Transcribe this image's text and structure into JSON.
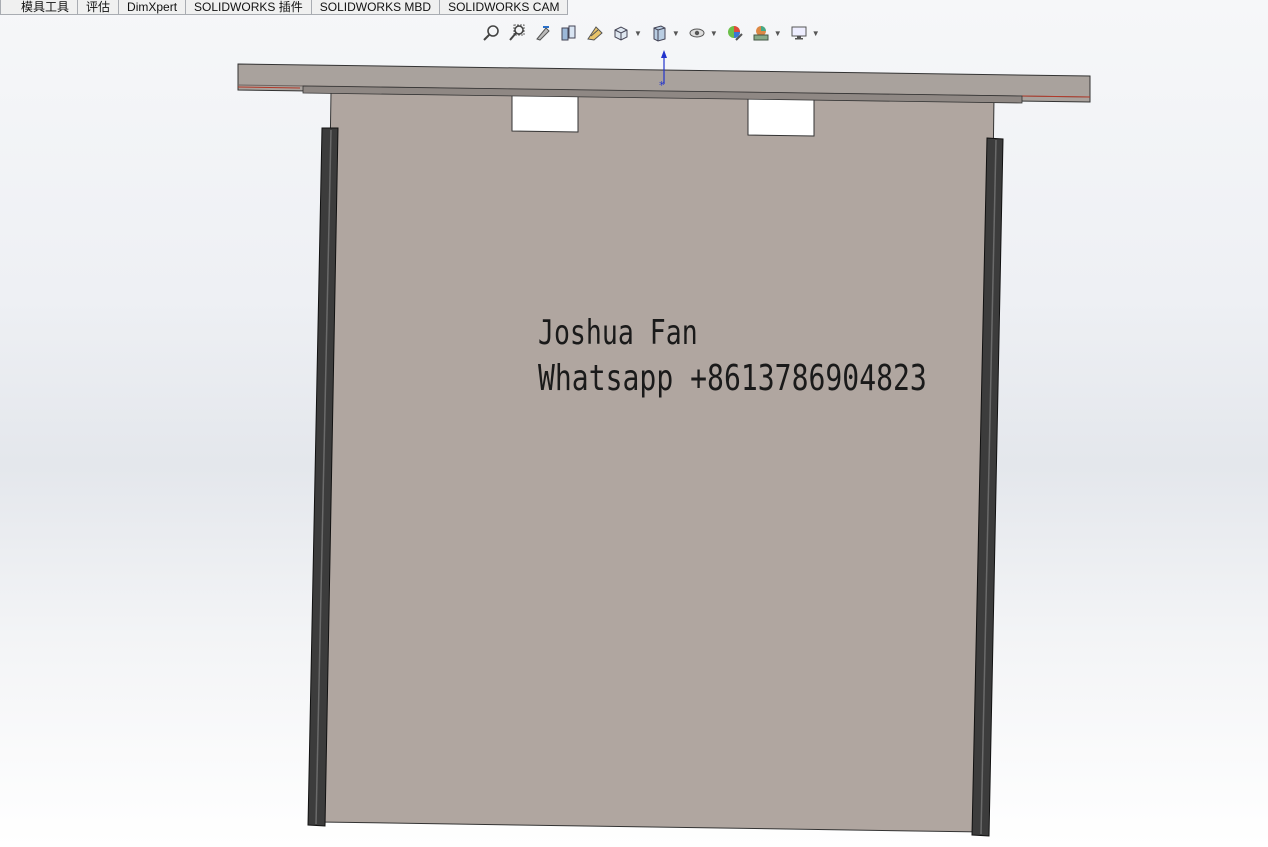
{
  "tabs": [
    "模具工具",
    "评估",
    "DimXpert",
    "SOLIDWORKS 插件",
    "SOLIDWORKS MBD",
    "SOLIDWORKS CAM"
  ],
  "hud": {
    "buttons": [
      "zoom-to-fit-icon",
      "zoom-to-area-icon",
      "previous-view-icon",
      "section-view-icon",
      "dynamic-annotation-icon",
      "view-orientation-icon",
      "display-style-icon",
      "hide-show-items-icon",
      "edit-appearance-icon",
      "apply-scene-icon",
      "view-settings-icon"
    ]
  },
  "model": {
    "note_line1": "Joshua  Fan",
    "note_line2": "Whatsapp +8613786904823",
    "plate_color": "#b0a6a0",
    "rail_color": "#3c3c3c",
    "bar_color": "#a9a29d"
  }
}
